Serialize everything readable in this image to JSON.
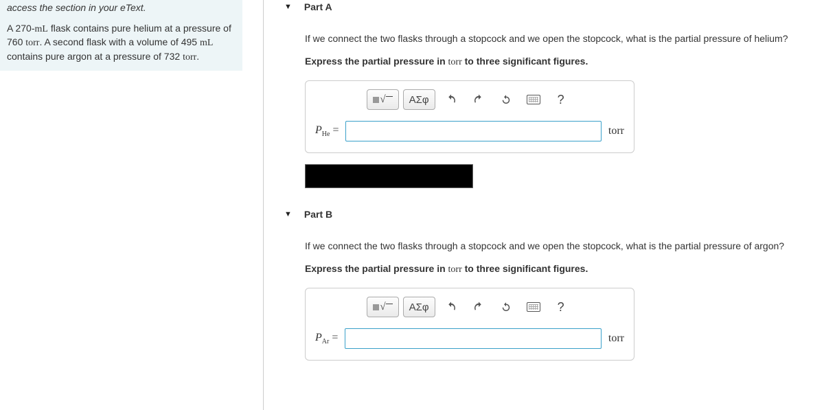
{
  "left": {
    "hint": "access the section in your eText.",
    "problem_pre1": "A 270-",
    "mL1": "mL",
    "problem_mid1": " flask contains pure helium at a pressure of 760 ",
    "torr1": "torr",
    "problem_mid2": ". A second flask with a volume of 495 ",
    "mL2": "mL",
    "problem_mid3": " contains pure argon at a pressure of 732 ",
    "torr2": "torr",
    "problem_end": "."
  },
  "partA": {
    "title": "Part A",
    "question": "If we connect the two flasks through a stopcock and we open the stopcock, what is the partial pressure of helium?",
    "instruction_pre": "Express the partial pressure in ",
    "instruction_unit": "torr",
    "instruction_post": " to three significant figures.",
    "greek_label": "ΑΣφ",
    "help": "?",
    "var_main": "P",
    "var_sub": "He",
    "equals": " =",
    "unit": "torr",
    "value": ""
  },
  "partB": {
    "title": "Part B",
    "question": "If we connect the two flasks through a stopcock and we open the stopcock, what is the partial pressure of argon?",
    "instruction_pre": "Express the partial pressure in ",
    "instruction_unit": "torr",
    "instruction_post": " to three significant figures.",
    "greek_label": "ΑΣφ",
    "help": "?",
    "var_main": "P",
    "var_sub": "Ar",
    "equals": " =",
    "unit": "torr",
    "value": ""
  }
}
